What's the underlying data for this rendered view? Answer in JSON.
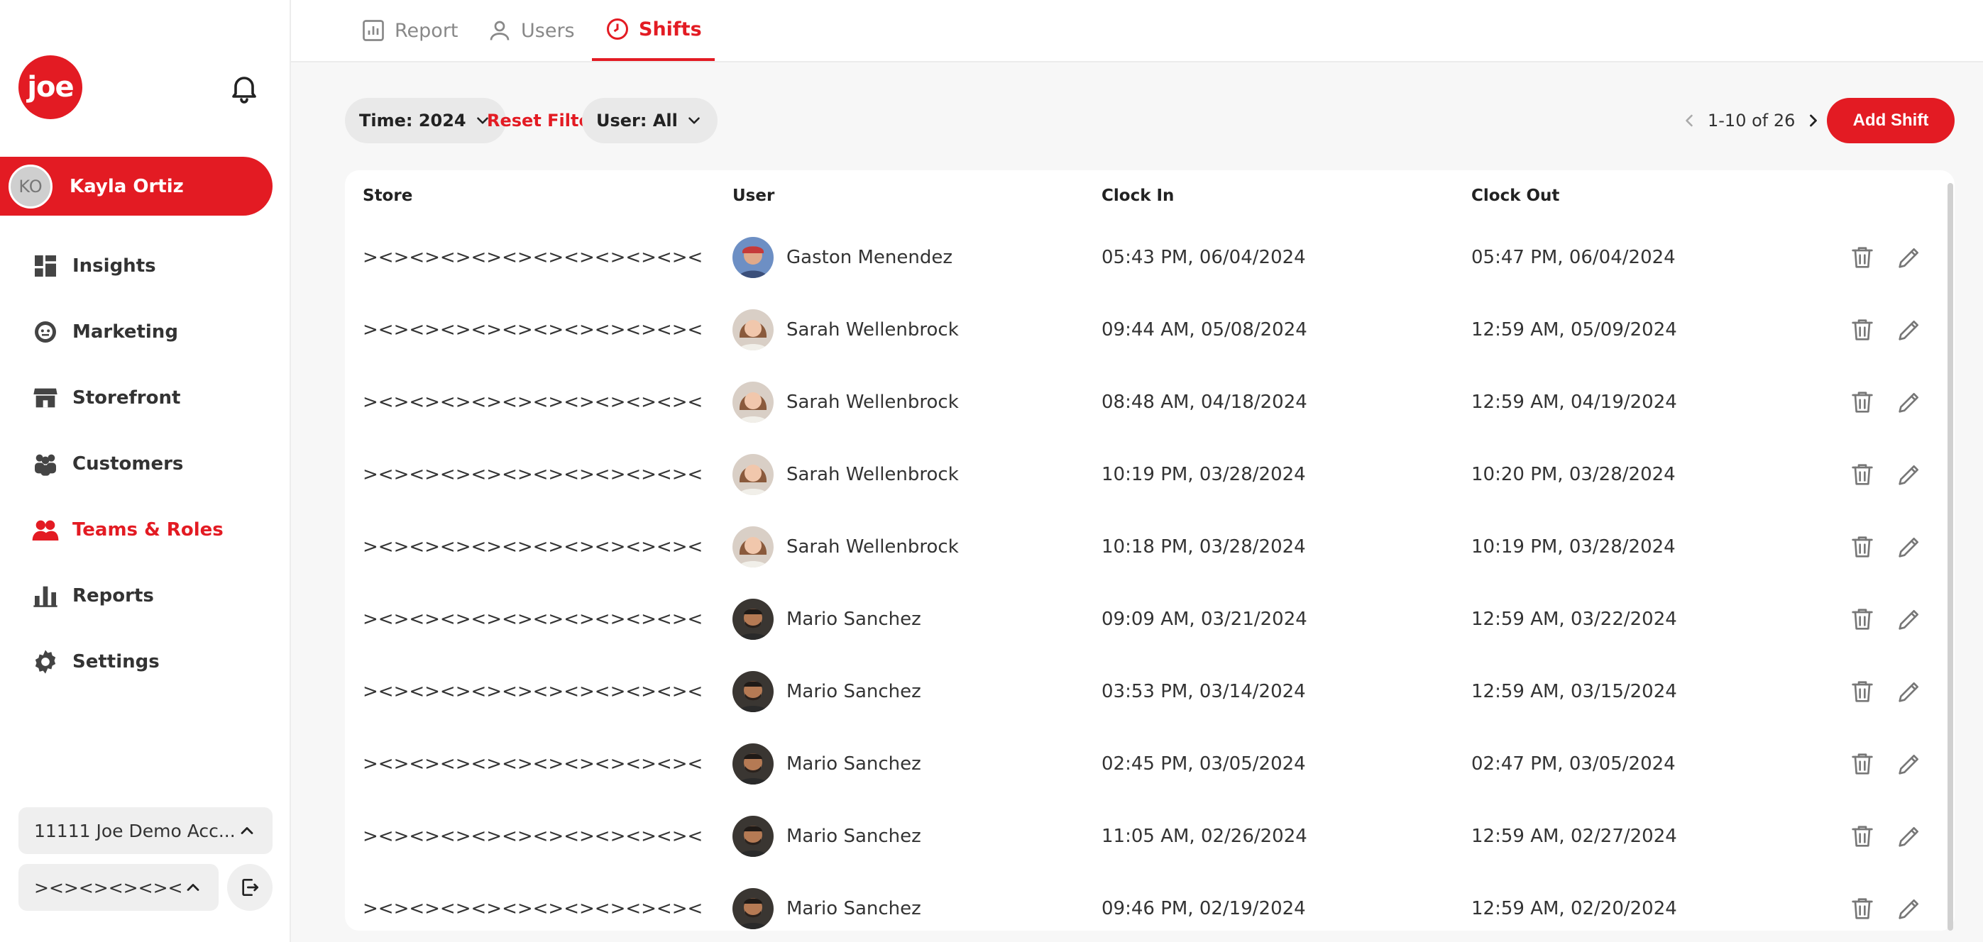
{
  "brand": {
    "logo_text": "joe",
    "accent": "#e31b23"
  },
  "user": {
    "initials": "KO",
    "name": "Kayla Ortiz"
  },
  "nav": [
    {
      "label": "Insights",
      "icon": "dashboard-icon"
    },
    {
      "label": "Marketing",
      "icon": "marketing-icon"
    },
    {
      "label": "Storefront",
      "icon": "store-icon"
    },
    {
      "label": "Customers",
      "icon": "customers-icon"
    },
    {
      "label": "Teams & Roles",
      "icon": "teams-icon",
      "active": true
    },
    {
      "label": "Reports",
      "icon": "bar-chart-icon"
    },
    {
      "label": "Settings",
      "icon": "gear-icon"
    }
  ],
  "account": {
    "label": "11111 Joe Demo Acc..."
  },
  "store": {
    "label": "><><><><><>..."
  },
  "tabs": [
    {
      "label": "Report",
      "icon": "report-icon"
    },
    {
      "label": "Users",
      "icon": "user-icon"
    },
    {
      "label": "Shifts",
      "icon": "clock-icon",
      "active": true
    }
  ],
  "filters": {
    "time": "Time: 2024",
    "reset": "Reset Filter",
    "user": "User: All"
  },
  "pagination": {
    "text": "1-10 of 26"
  },
  "add_button": "Add Shift",
  "table": {
    "headers": [
      "Store",
      "User",
      "Clock In",
      "Clock Out"
    ],
    "rows": [
      {
        "store": "><><><><><><><><><><><",
        "user": "Gaston Menendez",
        "avatar": "gaston",
        "clock_in": "05:43 PM, 06/04/2024",
        "clock_out": "05:47 PM, 06/04/2024"
      },
      {
        "store": "><><><><><><><><><><><",
        "user": "Sarah Wellenbrock",
        "avatar": "sarah",
        "clock_in": "09:44 AM, 05/08/2024",
        "clock_out": "12:59 AM, 05/09/2024"
      },
      {
        "store": "><><><><><><><><><><><",
        "user": "Sarah Wellenbrock",
        "avatar": "sarah",
        "clock_in": "08:48 AM, 04/18/2024",
        "clock_out": "12:59 AM, 04/19/2024"
      },
      {
        "store": "><><><><><><><><><><><",
        "user": "Sarah Wellenbrock",
        "avatar": "sarah",
        "clock_in": "10:19 PM, 03/28/2024",
        "clock_out": "10:20 PM, 03/28/2024"
      },
      {
        "store": "><><><><><><><><><><><",
        "user": "Sarah Wellenbrock",
        "avatar": "sarah",
        "clock_in": "10:18 PM, 03/28/2024",
        "clock_out": "10:19 PM, 03/28/2024"
      },
      {
        "store": "><><><><><><><><><><><",
        "user": "Mario Sanchez",
        "avatar": "mario",
        "clock_in": "09:09 AM, 03/21/2024",
        "clock_out": "12:59 AM, 03/22/2024"
      },
      {
        "store": "><><><><><><><><><><><",
        "user": "Mario Sanchez",
        "avatar": "mario",
        "clock_in": "03:53 PM, 03/14/2024",
        "clock_out": "12:59 AM, 03/15/2024"
      },
      {
        "store": "><><><><><><><><><><><",
        "user": "Mario Sanchez",
        "avatar": "mario",
        "clock_in": "02:45 PM, 03/05/2024",
        "clock_out": "02:47 PM, 03/05/2024"
      },
      {
        "store": "><><><><><><><><><><><",
        "user": "Mario Sanchez",
        "avatar": "mario",
        "clock_in": "11:05 AM, 02/26/2024",
        "clock_out": "12:59 AM, 02/27/2024"
      },
      {
        "store": "><><><><><><><><><><><",
        "user": "Mario Sanchez",
        "avatar": "mario",
        "clock_in": "09:46 PM, 02/19/2024",
        "clock_out": "12:59 AM, 02/20/2024"
      }
    ]
  }
}
